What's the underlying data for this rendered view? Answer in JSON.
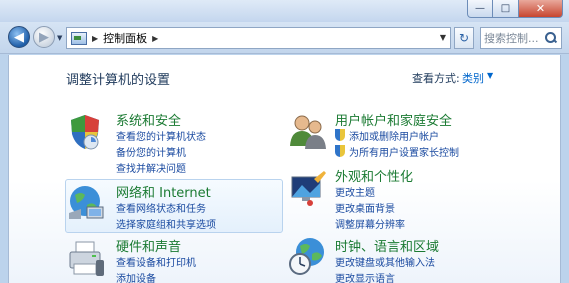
{
  "window": {
    "buttons": {
      "minimize": "—",
      "maximize": "□",
      "close": "✕"
    }
  },
  "navbar": {
    "back_glyph": "◀",
    "forward_glyph": "▶",
    "address": {
      "arrow": "▶",
      "path": "控制面板",
      "trail_arrow": "▶",
      "dropdown": "▼"
    },
    "refresh_glyph": "↻",
    "search_placeholder": "搜索控制..."
  },
  "main": {
    "title": "调整计算机的设置",
    "view_by_label": "查看方式:",
    "view_by_value": "类别",
    "view_by_caret": "▼",
    "categories": [
      {
        "icon": "security-shield-icon",
        "title": "系统和安全",
        "links": [
          "查看您的计算机状态",
          "备份您的计算机",
          "查找并解决问题"
        ]
      },
      {
        "icon": "network-globe-icon",
        "title": "网络和 Internet",
        "links": [
          "查看网络状态和任务",
          "选择家庭组和共享选项"
        ]
      },
      {
        "icon": "printer-icon",
        "title": "硬件和声音",
        "links": [
          "查看设备和打印机",
          "添加设备"
        ]
      },
      {
        "icon": "users-icon",
        "title": "用户帐户和家庭安全",
        "links": [
          "添加或删除用户帐户",
          "为所有用户设置家长控制"
        ]
      },
      {
        "icon": "appearance-icon",
        "title": "外观和个性化",
        "links": [
          "更改主题",
          "更改桌面背景",
          "调整屏幕分辨率"
        ]
      },
      {
        "icon": "clock-globe-icon",
        "title": "时钟、语言和区域",
        "links": [
          "更改键盘或其他输入法",
          "更改显示语言"
        ]
      }
    ]
  },
  "colors": {
    "category_title": "#1a7a32",
    "link": "#1a4aa0",
    "accent": "#0066cc"
  }
}
